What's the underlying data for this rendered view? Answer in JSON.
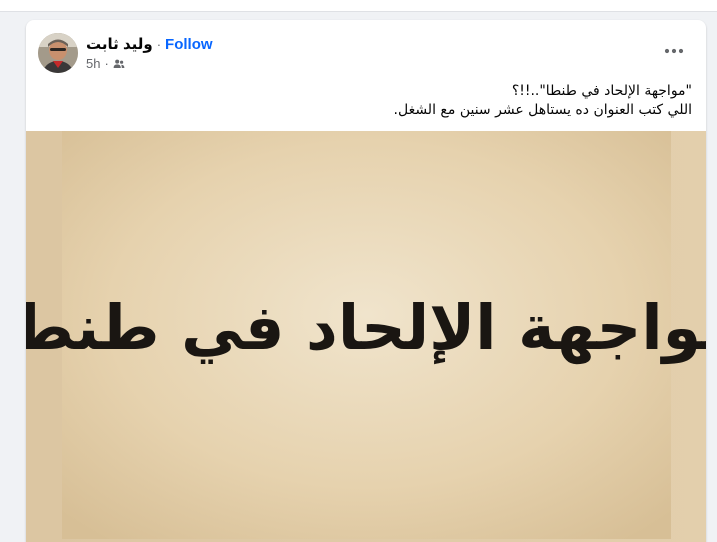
{
  "post": {
    "author_name": "وليد ثابت",
    "separator": "·",
    "follow_label": "Follow",
    "timestamp": "5h",
    "audience_icon": "friends-icon",
    "more_icon": "more-options-icon",
    "text_lines": [
      "\"مواجهة الإلحاد في طنطا\"..!!؟",
      "اللي كتب العنوان ده يستاهل عشر سنين مع الشغل."
    ],
    "image_caption_art": "مواجهة الإلحاد في طنطا"
  },
  "colors": {
    "accent": "#0866ff",
    "secondary_text": "#65676b",
    "parchment": "#e8d5b4"
  }
}
